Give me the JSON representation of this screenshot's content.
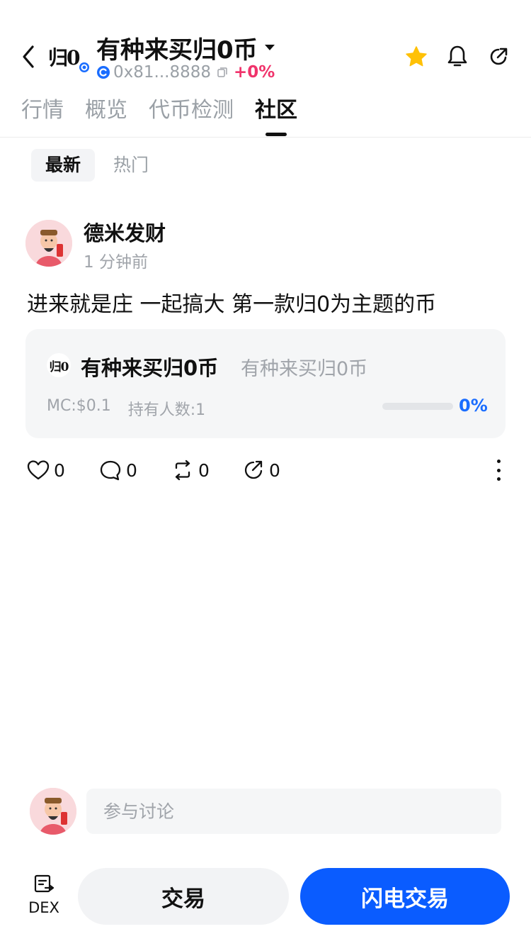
{
  "header": {
    "token_logo_text": "归0",
    "title": "有种来买归0币",
    "address": "0x81...8888",
    "change": "+0%",
    "icons": [
      "back-icon",
      "chain-icon",
      "copy-icon",
      "star-icon",
      "bell-icon",
      "share-icon"
    ],
    "colors": {
      "star": "#FFC107",
      "change": "#F0336B"
    }
  },
  "tabs": [
    {
      "label": "行情",
      "active": false
    },
    {
      "label": "概览",
      "active": false
    },
    {
      "label": "代币检测",
      "active": false
    },
    {
      "label": "社区",
      "active": true
    }
  ],
  "filters": [
    {
      "label": "最新",
      "active": true
    },
    {
      "label": "热门",
      "active": false
    }
  ],
  "post": {
    "author": "德米发财",
    "time": "1 分钟前",
    "text": "进来就是庄 一起搞大 第一款归0为主题的币",
    "token_card": {
      "logo_text": "归0",
      "name": "有种来买归0币",
      "symbol": "有种来买归0币",
      "market_cap": "MC:$0.1",
      "holders": "持有人数:1",
      "progress": 0,
      "progress_label": "0%"
    },
    "actions": {
      "likes": "0",
      "comments": "0",
      "reposts": "0",
      "shares": "0"
    }
  },
  "comment": {
    "placeholder": "参与讨论"
  },
  "bottom": {
    "dex_label": "DEX",
    "trade_label": "交易",
    "flash_trade_label": "闪电交易",
    "colors": {
      "flash": "#0A5CFF"
    }
  }
}
